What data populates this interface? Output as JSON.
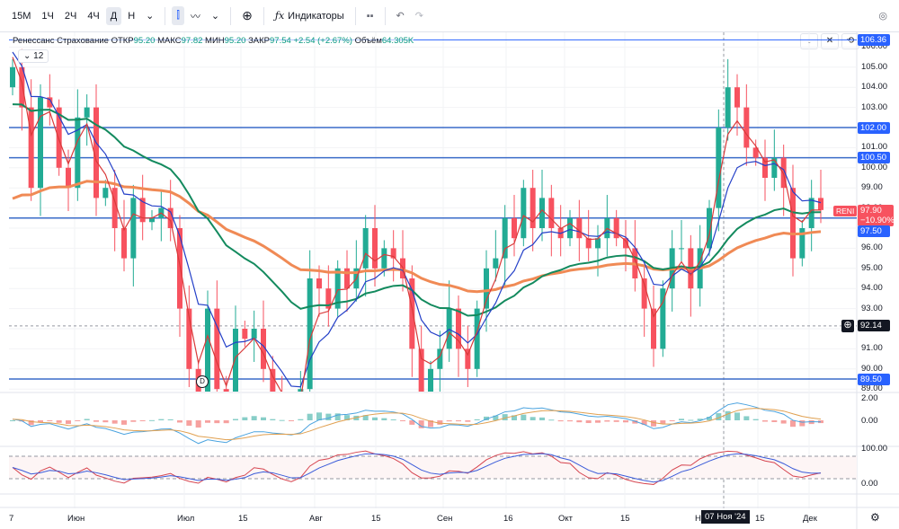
{
  "toolbar": {
    "intervals": [
      "15M",
      "1Ч",
      "2Ч",
      "4Ч",
      "Д",
      "Н"
    ],
    "active_interval": "Д",
    "indicators_label": "Индикаторы"
  },
  "legend": {
    "name": "Ренессанс Страхование",
    "open_label": "ОТКР",
    "open": "95.20",
    "high_label": "МАКС",
    "high": "97.82",
    "low_label": "МИН",
    "low": "95.20",
    "close_label": "ЗАКР",
    "close": "97.54",
    "change": "+2.54 (+2.67%)",
    "volume_label": "Объём",
    "volume": "64.305K",
    "collapsed_count": "12"
  },
  "price_axis": {
    "ticks": [
      "106.00",
      "105.00",
      "104.00",
      "103.00",
      "102.00",
      "101.00",
      "100.00",
      "99.00",
      "98.00",
      "97.00",
      "96.00",
      "95.00",
      "94.00",
      "93.00",
      "92.00",
      "91.00",
      "90.00",
      "89.00"
    ],
    "badges": {
      "alert": "106.36",
      "level1": "102.00",
      "level2": "100.50",
      "ticker": "RENI",
      "last": "97.90",
      "last_change": "−10.90%",
      "level3": "97.50",
      "crosshair": "92.14",
      "level4": "89.50"
    },
    "macd_ticks": [
      "2.00",
      "0.00"
    ],
    "osc_ticks": [
      "100.00",
      "0.00"
    ]
  },
  "time_axis": {
    "labels": [
      "7",
      "Июн",
      "Июл",
      "15",
      "Авг",
      "15",
      "Сен",
      "16",
      "Окт",
      "15",
      "Н",
      "15",
      "Дек"
    ],
    "crosshair": "07 Ноя '24"
  },
  "dividend_marker": "D",
  "colors": {
    "up": "#22ab94",
    "down": "#f7525f",
    "ema_fast": "#d93a3a",
    "ema_mid": "#2440c8",
    "ema_slow": "#138a5e",
    "ema_long": "#f08a55",
    "level": "#2962ff"
  },
  "chart_data": {
    "type": "candlestick",
    "levels": [
      106.36,
      102,
      100.5,
      97.5,
      89.5
    ],
    "crosshair_price": 92.14,
    "first_open": 104,
    "close": [
      105,
      103,
      99,
      103.5,
      103,
      100,
      99,
      102.5,
      103,
      98.5,
      99,
      97,
      95.5,
      98.5,
      97.3,
      97.5,
      98,
      97,
      93,
      90,
      88,
      93,
      89,
      88,
      92,
      91.5,
      92,
      90,
      88.5,
      88,
      87,
      89,
      94.5,
      94,
      93,
      95,
      94,
      95,
      97,
      95,
      96,
      95.5,
      94.5,
      91,
      88,
      90,
      91,
      93,
      91,
      90,
      93,
      95,
      95.5,
      97.5,
      96.5,
      99,
      97,
      98.5,
      97,
      96.5,
      97.5,
      96.5,
      96,
      96.5,
      97.5,
      96.5,
      96,
      94.5,
      93,
      91,
      94,
      96,
      96,
      94,
      96,
      98,
      102,
      104,
      103,
      101,
      100.5,
      99.5,
      100.5,
      99,
      95.5,
      97,
      98.5,
      97.9
    ]
  }
}
